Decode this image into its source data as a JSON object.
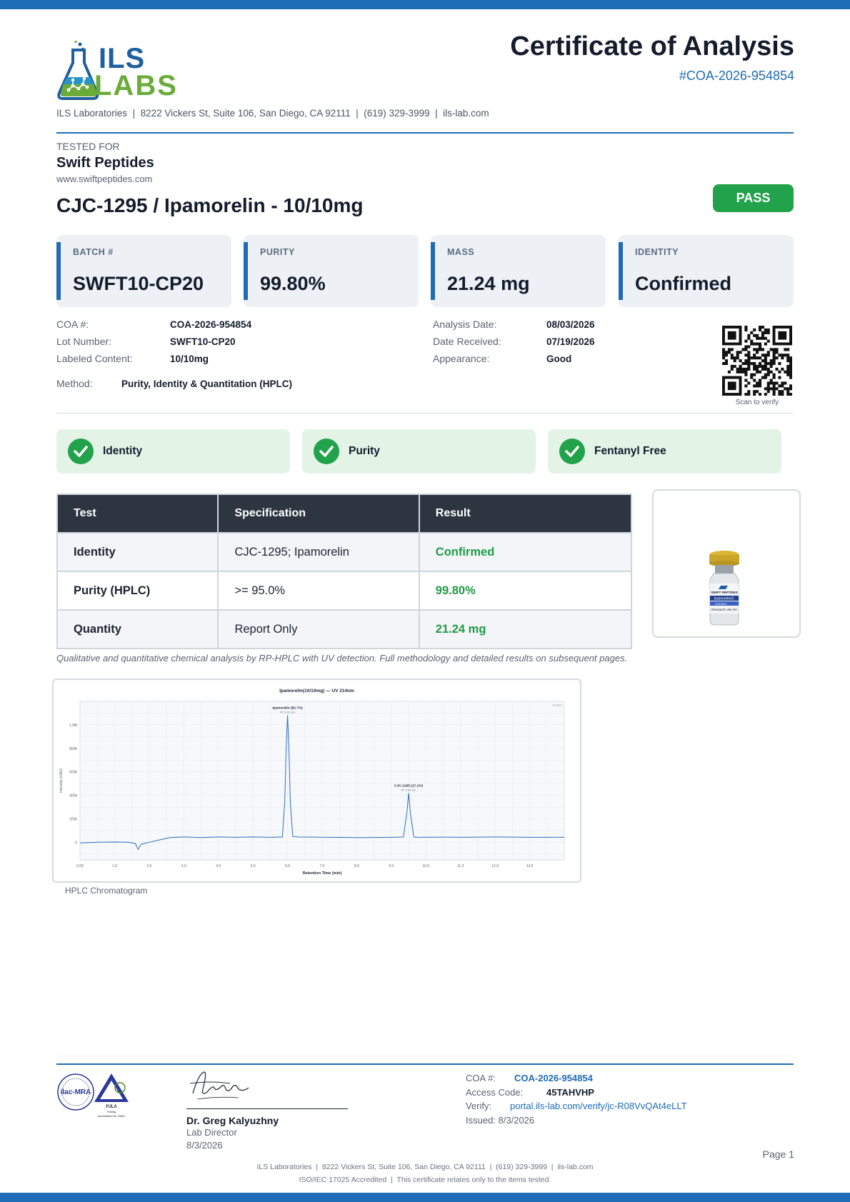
{
  "header": {
    "logo_text_top": "ILS",
    "logo_text_bottom": "LABS",
    "title": "Certificate of Analysis",
    "coa_number": "#COA-2026-954854",
    "lab_line": "ILS Laboratories  |  8222 Vickers St, Suite 106, San Diego, CA 92111  |  (619) 329-3999  |  ils-lab.com"
  },
  "client": {
    "label": "TESTED FOR",
    "name": "Swift Peptides",
    "url": "www.swiftpeptides.com"
  },
  "product": {
    "title": "CJC-1295 / Ipamorelin - 10/10mg",
    "status": "PASS"
  },
  "stats": [
    {
      "label": "BATCH #",
      "value": "SWFT10-CP20"
    },
    {
      "label": "PURITY",
      "value": "99.80%"
    },
    {
      "label": "MASS",
      "value": "21.24 mg"
    },
    {
      "label": "IDENTITY",
      "value": "Confirmed"
    }
  ],
  "info": {
    "coa_label": "COA #:",
    "coa_value": "COA-2026-954854",
    "lot_label": "Lot Number:",
    "lot_value": "SWFT10-CP20",
    "content_label": "Labeled Content:",
    "content_value": "10/10mg",
    "method_label": "Method:",
    "method_value": "Purity, Identity & Quantitation (HPLC)",
    "analysis_label": "Analysis Date:",
    "analysis_value": "08/03/2026",
    "received_label": "Date Received:",
    "received_value": "07/19/2026",
    "appearance_label": "Appearance:",
    "appearance_value": "Good",
    "qr_caption": "Scan to verify"
  },
  "checks": [
    {
      "label": "Identity",
      "icon": "check-icon"
    },
    {
      "label": "Purity",
      "icon": "check-icon"
    },
    {
      "label": "Fentanyl Free",
      "icon": "check-icon"
    }
  ],
  "results_table": {
    "headers": [
      "Test",
      "Specification",
      "Result"
    ],
    "rows": [
      [
        "Identity",
        "CJC-1295; Ipamorelin",
        "Confirmed"
      ],
      [
        "Purity (HPLC)",
        ">= 95.0%",
        "99.80%"
      ],
      [
        "Quantity",
        "Report Only",
        "21.24 mg"
      ]
    ],
    "result_color": "#1f9a46"
  },
  "vial_label": {
    "brand": "SWIFT PEPTIDES",
    "name": "Ipamorelin/C",
    "band": "10/10MG",
    "use": "Research Use On"
  },
  "method_note": "Qualitative and quantitative chemical analysis by RP-HPLC with UV detection. Full methodology and detailed results on subsequent pages.",
  "chart_data": {
    "type": "line",
    "title": "Ipamorelin(10/10mg) — UV 214nm",
    "xlabel": "Retention Time (min)",
    "ylabel": "Intensity (mAU)",
    "xlim": [
      0,
      14
    ],
    "ylim": [
      -150000,
      1200000
    ],
    "x_ticks": [
      "0.00",
      "1.0",
      "2.0",
      "3.0",
      "4.0",
      "5.0",
      "6.0",
      "7.0",
      "8.0",
      "9.0",
      "10.0",
      "11.0",
      "12.0",
      "13.0"
    ],
    "y_ticks": [
      {
        "value": 0,
        "label": "0"
      },
      {
        "value": 200000,
        "label": "200k"
      },
      {
        "value": 400000,
        "label": "400k"
      },
      {
        "value": 600000,
        "label": "600k"
      },
      {
        "value": 800000,
        "label": "800k"
      },
      {
        "value": 1000000,
        "label": "1.0M"
      }
    ],
    "corner_label": "214nm",
    "grid": true,
    "series": [
      {
        "color": "#2a6fbf",
        "x": [
          0,
          0.5,
          1.0,
          1.4,
          1.6,
          1.68,
          1.72,
          1.76,
          1.85,
          2.0,
          2.3,
          2.6,
          3.0,
          3.5,
          4.0,
          4.5,
          5.0,
          5.5,
          5.85,
          5.92,
          5.96,
          6.0,
          6.04,
          6.08,
          6.15,
          6.3,
          7.0,
          8.0,
          9.0,
          9.35,
          9.45,
          9.5,
          9.55,
          9.65,
          9.8,
          10.5,
          11.0,
          12.0,
          13.0,
          14.0
        ],
        "y": [
          -5000,
          0,
          2000,
          0,
          -10000,
          -60000,
          -40000,
          -20000,
          -10000,
          0,
          20000,
          40000,
          45000,
          40000,
          45000,
          42000,
          45000,
          42000,
          45000,
          350000,
          800000,
          1080000,
          800000,
          350000,
          50000,
          45000,
          43000,
          40000,
          42000,
          45000,
          250000,
          420000,
          250000,
          45000,
          42000,
          44000,
          42000,
          45000,
          42000,
          43000
        ]
      }
    ],
    "peaks": [
      {
        "x": 6.0,
        "y": 1080000,
        "label": "Ipamorelin (82.7%)",
        "sub": "RT 6.02 min"
      },
      {
        "x": 9.5,
        "y": 420000,
        "label": "CJC-1295 (17.1%)",
        "sub": "RT 9.50 min"
      }
    ]
  },
  "chart_caption": "HPLC Chromatogram",
  "footer": {
    "seal1_text": "ilac-MRA",
    "seal2_text": "PJLA",
    "seal2_sub": "Testing",
    "seal2_acc": "Accreditation No. 99602",
    "signer_name": "Dr. Greg Kalyuzhny",
    "signer_role": "Lab Director",
    "signer_date": "8/3/2026",
    "coa_label": "COA #:",
    "coa_value": "COA-2026-954854",
    "access_label": "Access Code:",
    "access_value": "45TAHVHP",
    "verify_label": "Verify:",
    "verify_value": "portal.ils-lab.com/verify/jc-R08VvQAt4eLLT",
    "issued": "Issued: 8/3/2026",
    "page": "Page 1",
    "address": "ILS Laboratories  |  8222 Vickers St, Suite 106, San Diego, CA 92111  |  (619) 329-3999  |  ils-lab.com",
    "iso": "ISO/IEC 17025 Accredited  |  This certificate relates only to the items tested."
  },
  "colors": {
    "brand_blue": "#1e6cb5",
    "pass_green": "#22a24a",
    "check_bg": "#e3f4e7",
    "table_header": "#2c3540"
  }
}
